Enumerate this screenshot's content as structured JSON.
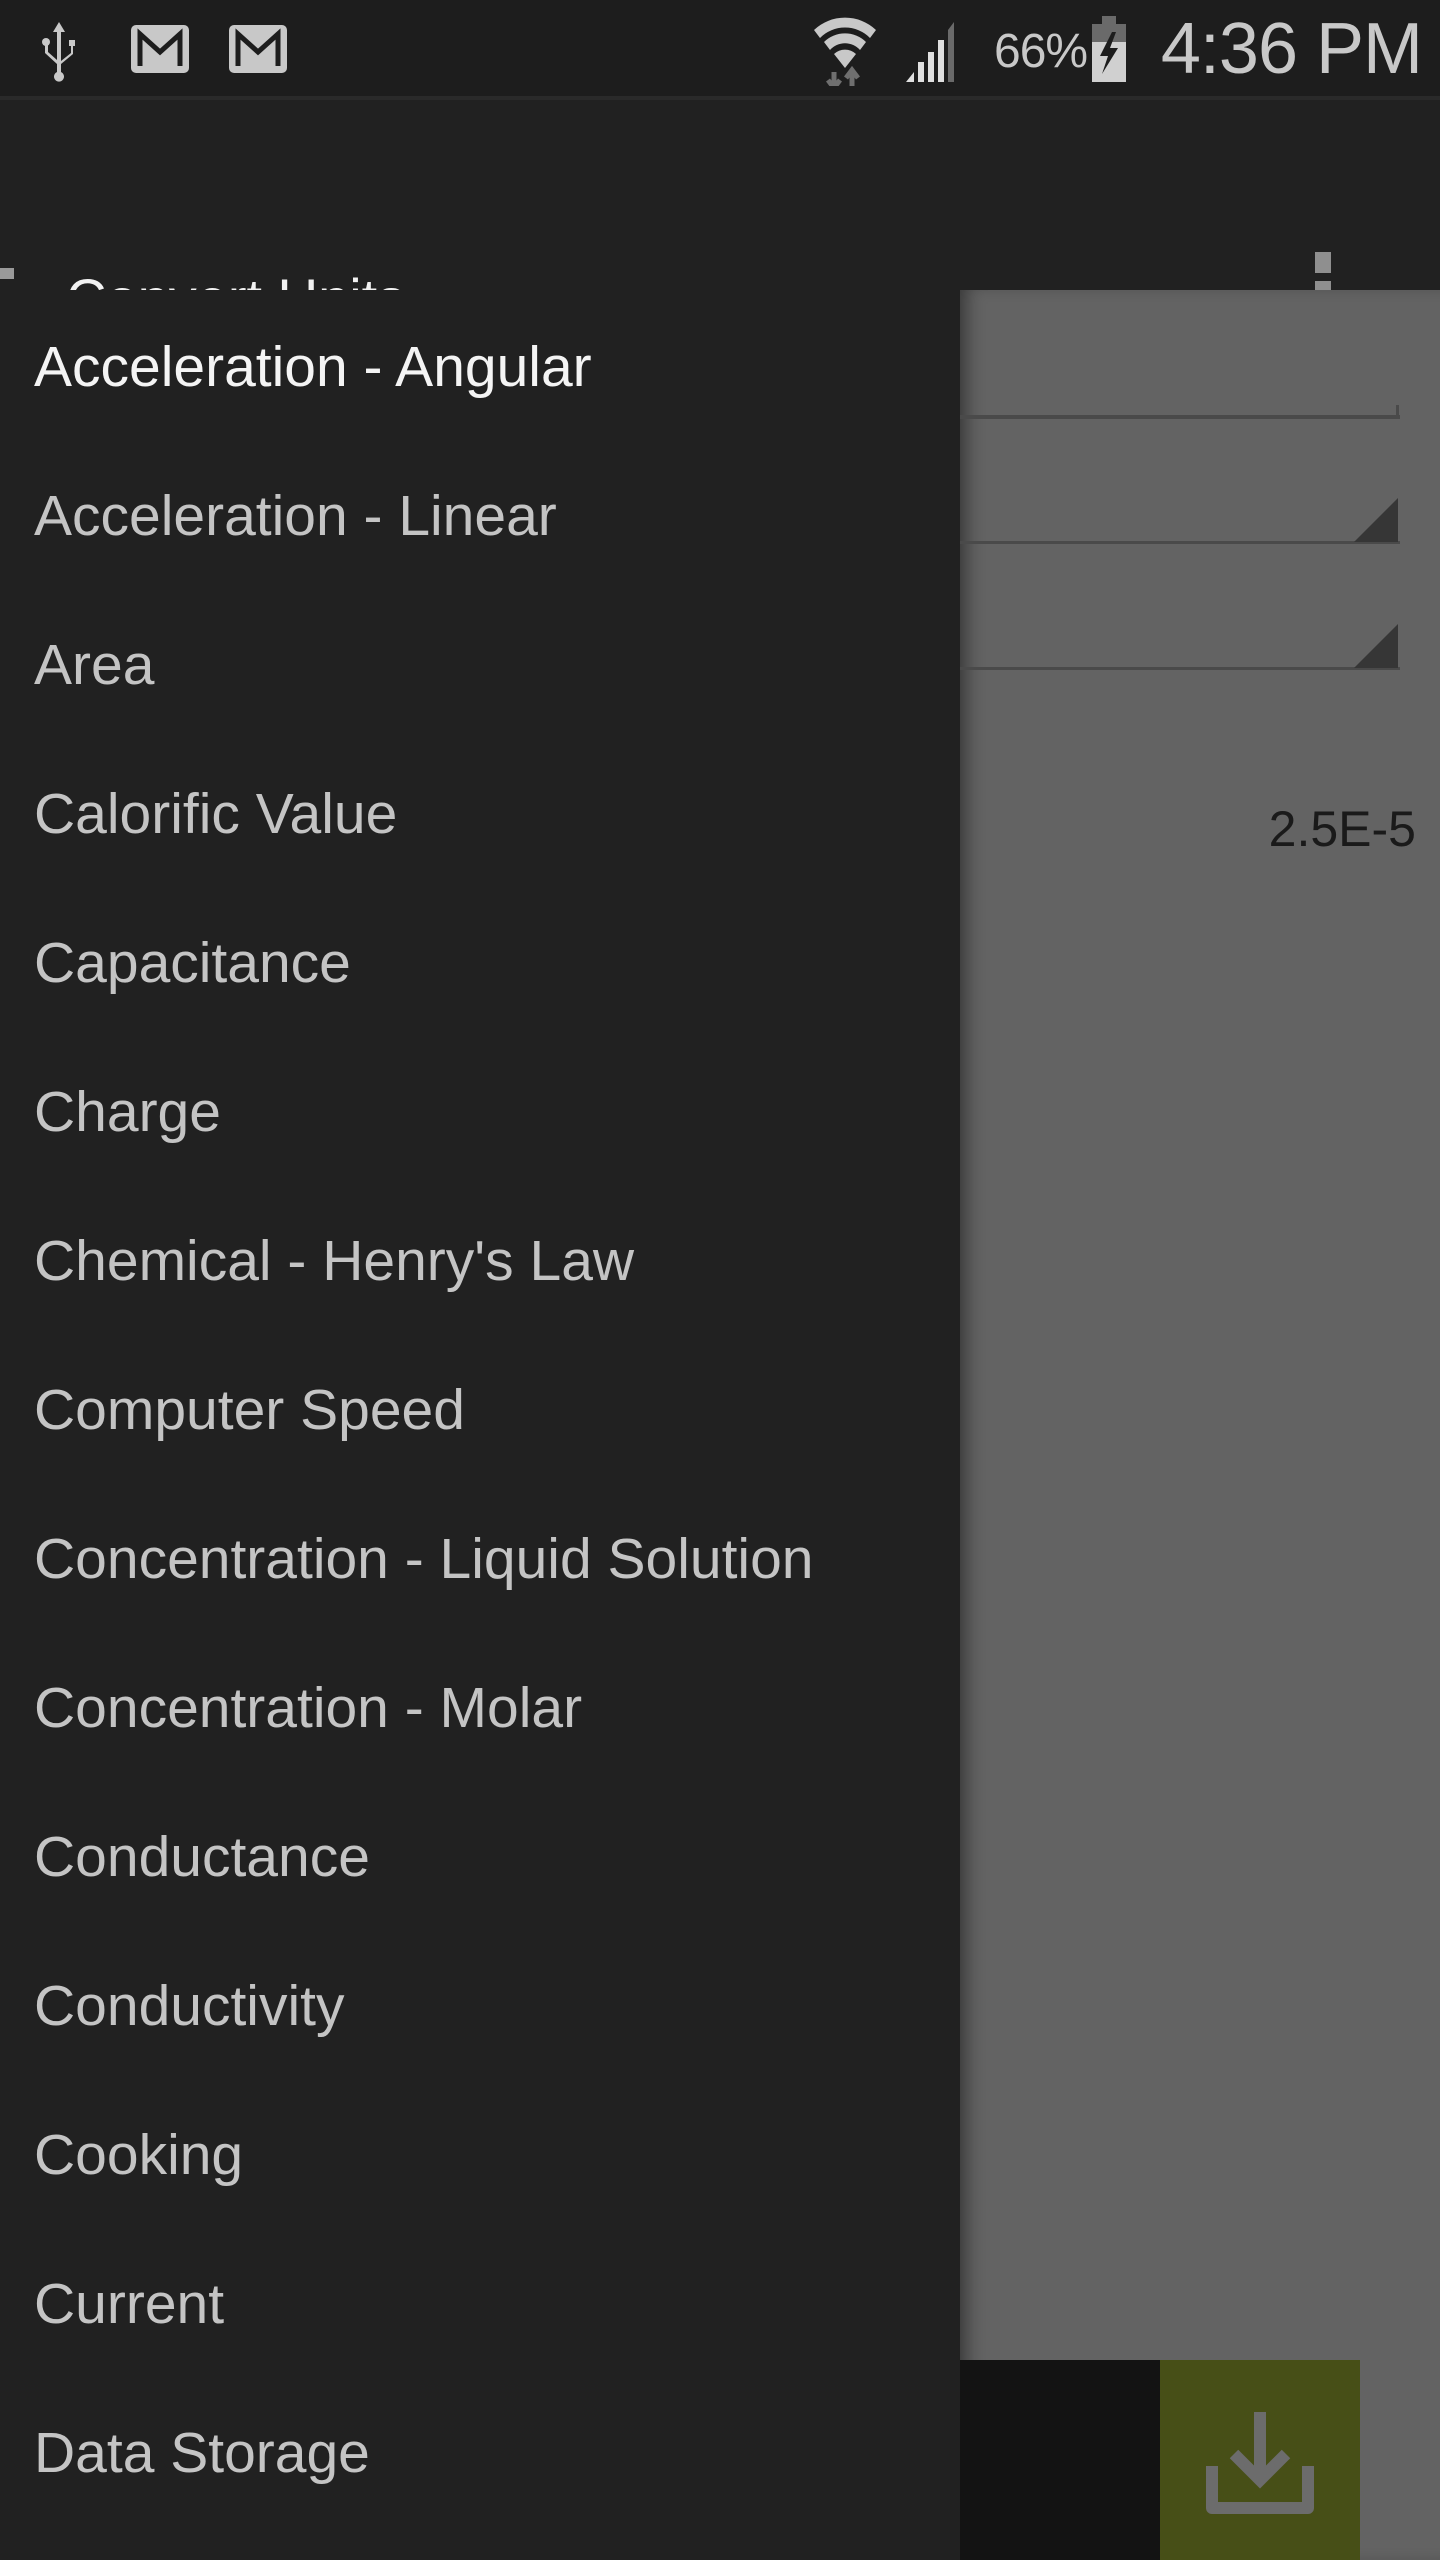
{
  "status_bar": {
    "icons": [
      "usb-icon",
      "gmail-icon",
      "gmail-icon",
      "wifi-icon",
      "cell-signal-icon",
      "battery-charging-icon"
    ],
    "battery_percent": "66%",
    "time": "4:36 PM"
  },
  "action_bar": {
    "title": "Convert Units",
    "drawer_icon": "drawer-indicator-icon",
    "overflow_icon": "overflow-menu-icon"
  },
  "drawer": {
    "items": [
      {
        "label": "Acceleration - Angular",
        "active": true
      },
      {
        "label": "Acceleration - Linear"
      },
      {
        "label": "Area"
      },
      {
        "label": "Calorific Value"
      },
      {
        "label": "Capacitance"
      },
      {
        "label": "Charge"
      },
      {
        "label": "Chemical - Henry's Law"
      },
      {
        "label": "Computer Speed"
      },
      {
        "label": "Concentration - Liquid Solution"
      },
      {
        "label": "Concentration - Molar"
      },
      {
        "label": "Conductance"
      },
      {
        "label": "Conductivity"
      },
      {
        "label": "Cooking"
      },
      {
        "label": "Current"
      },
      {
        "label": "Data Storage"
      }
    ]
  },
  "content": {
    "result_value": "2.5E-5",
    "download_icon": "download-icon",
    "accent_color": "#474f17"
  }
}
